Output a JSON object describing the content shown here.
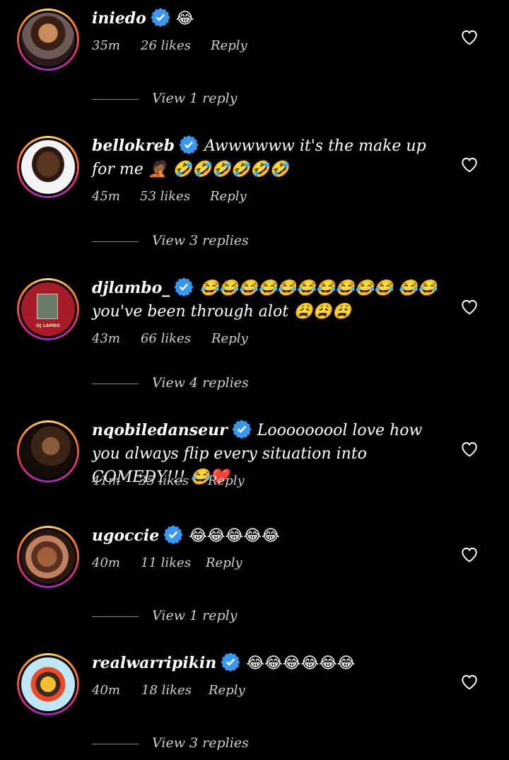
{
  "comments": [
    {
      "username": "iniedo",
      "text": "😂",
      "time": "35m",
      "likes": "26 likes",
      "reply": "Reply",
      "view_replies": "View 1 reply"
    },
    {
      "username": "bellokreb",
      "text": "Awwwwww it's the make up for me 🤦🏾 🤣🤣🤣🤣🤣🤣",
      "time": "45m",
      "likes": "53 likes",
      "reply": "Reply",
      "view_replies": "View 3 replies"
    },
    {
      "username": "djlambo_",
      "text": "😂😂😂😂😂😂😂😂😂😂 😂😂 you've been through alot 😩😩😩",
      "time": "43m",
      "likes": "66 likes",
      "reply": "Reply",
      "view_replies": "View 4 replies",
      "avatar_caption": "DJ LAMBO"
    },
    {
      "username": "nqobiledanseur",
      "text": "Looooooool love how you always flip every situation into COMEDY!!! 😂❤️",
      "time": "41m",
      "likes": "35 likes",
      "reply": "Reply"
    },
    {
      "username": "ugoccie",
      "text": "😂😂😂😂😂",
      "time": "40m",
      "likes": "11 likes",
      "reply": "Reply",
      "view_replies": "View 1 reply"
    },
    {
      "username": "realwarripikin",
      "text": "😂😂😂😂😂😂",
      "time": "40m",
      "likes": "18 likes",
      "reply": "Reply",
      "view_replies": "View 3 replies"
    }
  ],
  "colors": {
    "background": "#000000",
    "verified": "#3897f0",
    "meta_text": "#cfcfcf"
  },
  "icons": {
    "like": "heart-outline-icon",
    "verified": "verified-badge-icon"
  }
}
